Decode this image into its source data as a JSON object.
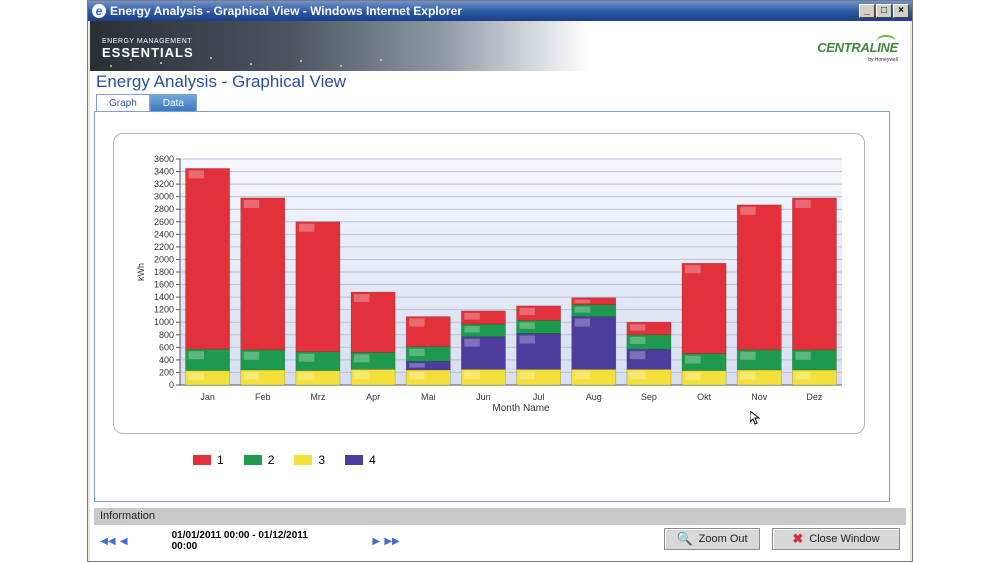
{
  "window": {
    "title": "Energy Analysis - Graphical View - Windows Internet Explorer",
    "buttons": [
      "_",
      "□",
      "×"
    ]
  },
  "brand": {
    "line1": "ENERGY MANAGEMENT",
    "line2": "ESSENTIALS",
    "logo_name": "CENTRALINE",
    "logo_sub": "by Honeywell"
  },
  "page_title": "Energy Analysis - Graphical View",
  "tabs": [
    {
      "label": "Graph",
      "active": true
    },
    {
      "label": "Data",
      "active": false
    }
  ],
  "chart_data": {
    "type": "bar",
    "stacked": true,
    "ylabel": "kWh",
    "xlabel": "Month Name",
    "ylim": [
      0,
      3600
    ],
    "yticks": [
      0,
      200,
      400,
      600,
      800,
      1000,
      1200,
      1400,
      1600,
      1800,
      2000,
      2200,
      2400,
      2600,
      2800,
      3000,
      3200,
      3400,
      3600
    ],
    "categories": [
      "Jan",
      "Feb",
      "Mrz",
      "Apr",
      "Mai",
      "Jun",
      "Jul",
      "Aug",
      "Sep",
      "Okt",
      "Nov",
      "Dez"
    ],
    "series": [
      {
        "name": "3",
        "color": "#f4e03a",
        "values": [
          230,
          240,
          230,
          250,
          240,
          250,
          250,
          250,
          250,
          230,
          240,
          240
        ]
      },
      {
        "name": "4",
        "color": "#4b3c9e",
        "values": [
          0,
          0,
          0,
          0,
          140,
          520,
          570,
          840,
          320,
          0,
          0,
          0
        ]
      },
      {
        "name": "2",
        "color": "#1e9a4e",
        "values": [
          340,
          320,
          300,
          270,
          230,
          200,
          210,
          190,
          230,
          270,
          320,
          320
        ]
      },
      {
        "name": "1",
        "color": "#e2313b",
        "values": [
          2880,
          2420,
          2070,
          960,
          480,
          210,
          230,
          110,
          200,
          1440,
          2310,
          2420
        ]
      }
    ],
    "legend": [
      {
        "label": "1",
        "color": "#e2313b"
      },
      {
        "label": "2",
        "color": "#1e9a4e"
      },
      {
        "label": "3",
        "color": "#f4e03a"
      },
      {
        "label": "4",
        "color": "#4b3c9e"
      }
    ]
  },
  "info": {
    "label": "Information",
    "range": "01/01/2011 00:00 - 01/12/2011 00:00"
  },
  "nav": {
    "first": "◀◀",
    "prev": "◀",
    "next": "▶",
    "last": "▶▶"
  },
  "buttons": {
    "zoom_out": "Zoom Out",
    "close_window": "Close Window",
    "zoom_icon": "magnifier-icon",
    "close_icon": "x-icon"
  }
}
